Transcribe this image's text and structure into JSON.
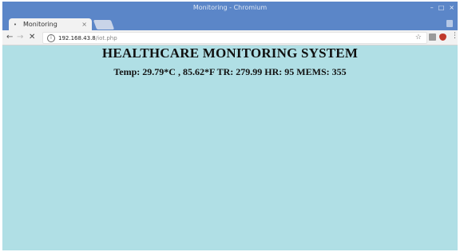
{
  "window": {
    "title": "Monitoring - Chromium",
    "controls": {
      "minimize": "–",
      "maximize": "□",
      "close": "×"
    }
  },
  "tabs": [
    {
      "title": "Monitoring",
      "close": "×",
      "favicon": "loading-dot"
    }
  ],
  "toolbar": {
    "back": "←",
    "forward": "→",
    "stop": "✕",
    "url_host": "192.168.43.8",
    "url_path": "/iot.php",
    "star": "☆",
    "menu": "⋮"
  },
  "page": {
    "heading": "HEALTHCARE MONITORING SYSTEM",
    "readings": "Temp: 29.79*C , 85.62*F TR: 279.99 HR: 95 MEMS: 355"
  },
  "colors": {
    "title_bar": "#5b86c8",
    "page_background": "#b0dfe5",
    "text": "#111111"
  },
  "icons": {
    "back": "back-arrow-icon",
    "forward": "forward-arrow-icon",
    "stop": "stop-icon",
    "info": "info-icon",
    "star": "bookmark-star-icon",
    "ext1": "extension-icon",
    "ext2": "shield-extension-icon",
    "menu": "kebab-menu-icon"
  }
}
